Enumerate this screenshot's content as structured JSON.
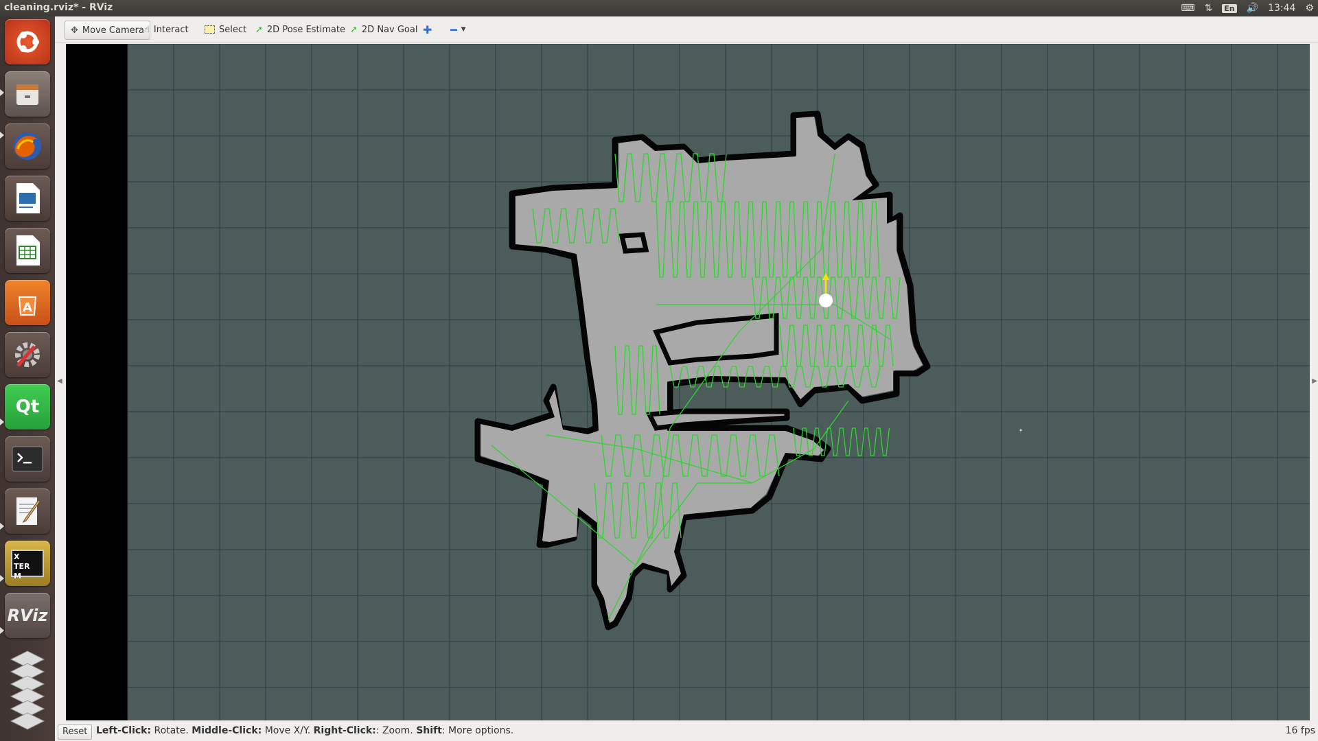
{
  "window": {
    "title": "cleaning.rviz* - RViz"
  },
  "tray": {
    "language": "En",
    "clock": "13:44"
  },
  "toolbar": {
    "move_camera": "Move Camera",
    "interact": "Interact",
    "select": "Select",
    "pose_estimate": "2D Pose Estimate",
    "nav_goal": "2D Nav Goal"
  },
  "launcher": [
    {
      "name": "ubuntu-dash-icon"
    },
    {
      "name": "files-icon"
    },
    {
      "name": "firefox-icon"
    },
    {
      "name": "libreoffice-impress-icon"
    },
    {
      "name": "libreoffice-calc-icon"
    },
    {
      "name": "software-center-icon"
    },
    {
      "name": "system-settings-icon"
    },
    {
      "name": "qt-creator-icon",
      "label": "Qt"
    },
    {
      "name": "terminal-icon"
    },
    {
      "name": "text-editor-icon"
    },
    {
      "name": "xterm-icon",
      "label": "X TERM"
    },
    {
      "name": "rviz-icon",
      "label": "RViz"
    },
    {
      "name": "workspace-switcher-icon"
    }
  ],
  "status": {
    "reset": "Reset",
    "k1": "Left-Click:",
    "v1": " Rotate. ",
    "k2": "Middle-Click:",
    "v2": " Move X/Y. ",
    "k3": "Right-Click:",
    "v3": ": Zoom. ",
    "k4": "Shift",
    "v4": ": More options.",
    "fps": "16 fps"
  },
  "colors": {
    "grid_background": "#4b5c5b",
    "map_free": "#a9a9a9",
    "map_wall": "#000000",
    "path": "#2fd52f",
    "robot": "#ffffff",
    "heading": "#f2e600"
  }
}
